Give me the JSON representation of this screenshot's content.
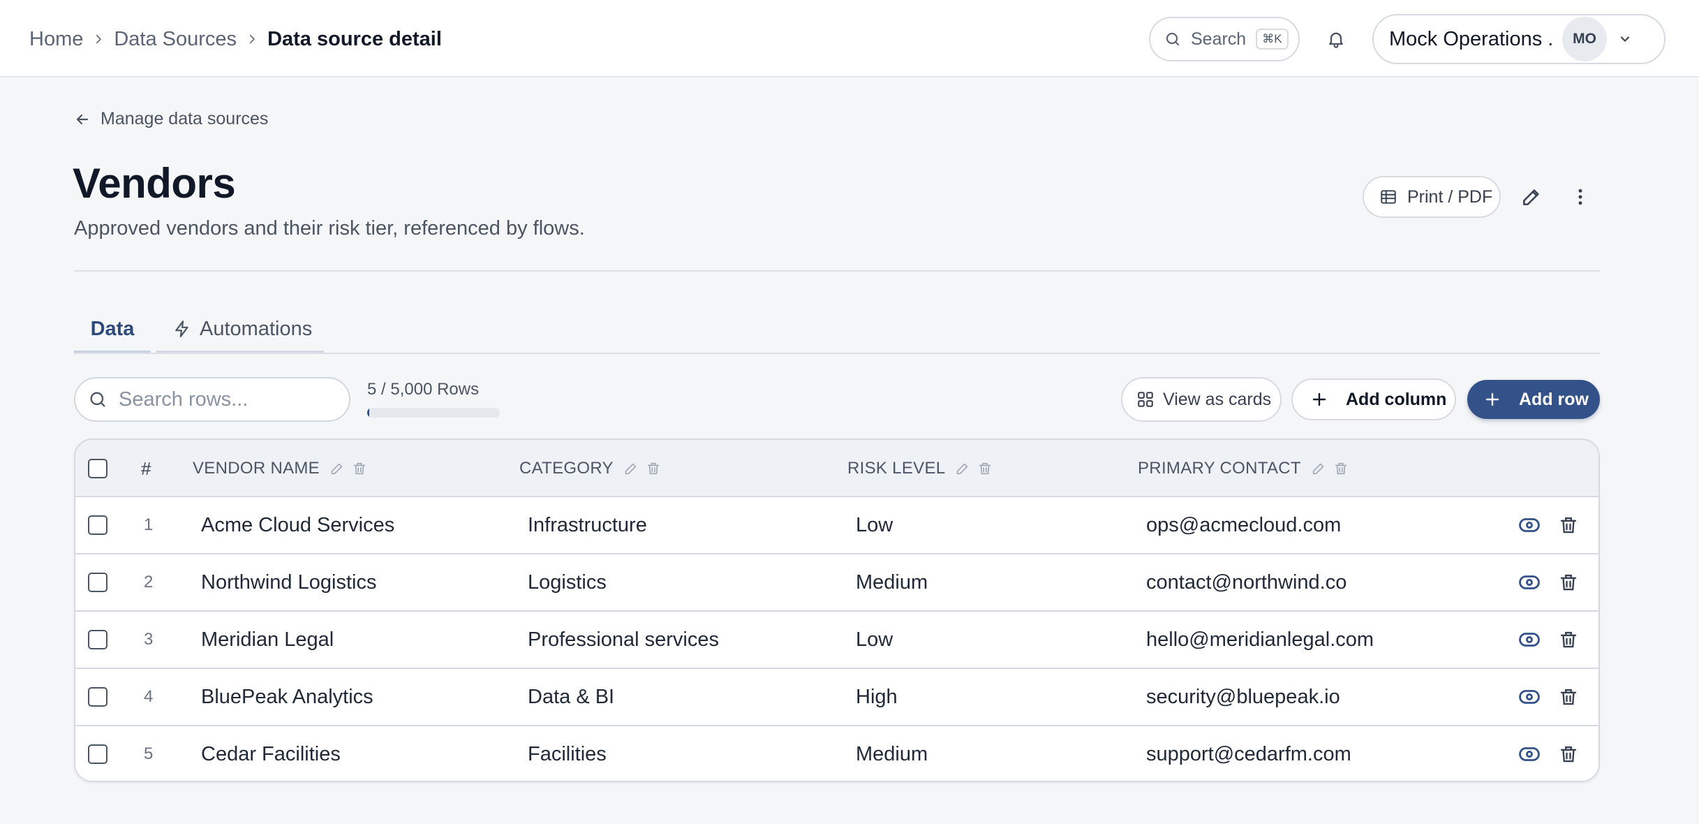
{
  "breadcrumb": {
    "home": "Home",
    "sources": "Data Sources",
    "current": "Data source detail"
  },
  "topbar": {
    "search_label": "Search",
    "search_shortcut": "⌘K",
    "account_name": "Mock Operations ...",
    "avatar_initials": "MO"
  },
  "header": {
    "back_link": "Manage data sources",
    "title": "Vendors",
    "subtitle": "Approved vendors and their risk tier, referenced by flows.",
    "print_label": "Print / PDF"
  },
  "tabs": [
    {
      "label": "Data",
      "active": true
    },
    {
      "label": "Automations",
      "active": false
    }
  ],
  "toolbar": {
    "search_placeholder": "Search rows...",
    "rows_count": "5 / 5,000 Rows",
    "rows_fraction": 0.001,
    "view_cards_label": "View as cards",
    "add_column_label": "Add column",
    "add_row_label": "Add row"
  },
  "table": {
    "columns": [
      "#",
      "VENDOR NAME",
      "CATEGORY",
      "RISK LEVEL",
      "PRIMARY CONTACT"
    ],
    "rows": [
      {
        "num": "1",
        "vendor": "Acme Cloud Services",
        "category": "Infrastructure",
        "risk": "Low",
        "contact": "ops@acmecloud.com"
      },
      {
        "num": "2",
        "vendor": "Northwind Logistics",
        "category": "Logistics",
        "risk": "Medium",
        "contact": "contact@northwind.co"
      },
      {
        "num": "3",
        "vendor": "Meridian Legal",
        "category": "Professional services",
        "risk": "Low",
        "contact": "hello@meridianlegal.com"
      },
      {
        "num": "4",
        "vendor": "BluePeak Analytics",
        "category": "Data & BI",
        "risk": "High",
        "contact": "security@bluepeak.io"
      },
      {
        "num": "5",
        "vendor": "Cedar Facilities",
        "category": "Facilities",
        "risk": "Medium",
        "contact": "support@cedarfm.com"
      }
    ]
  },
  "colors": {
    "accent": "#34528a",
    "active_tab": "#2e4a7d"
  }
}
